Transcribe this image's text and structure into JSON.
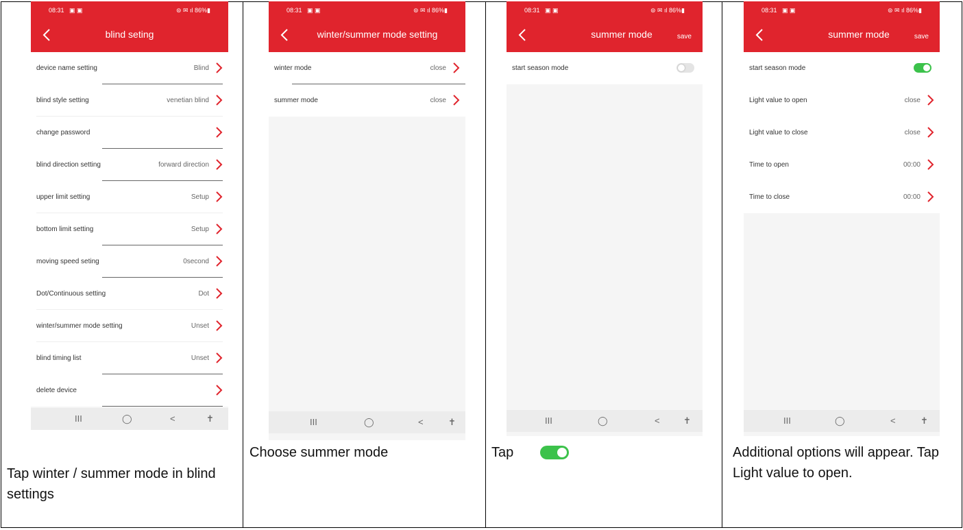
{
  "colors": {
    "accent": "#e0242d",
    "toggle_on": "#3cc24b",
    "toggle_off": "#e4e4e4"
  },
  "status_bar": {
    "time": "08:31",
    "icons": "▣ ▣",
    "right": "⊜ ✉ ıl 86%▮"
  },
  "nav_icons": {
    "recents": "III",
    "home": "◯",
    "back": "<",
    "accessibility": "✝"
  },
  "panel1": {
    "title": "blind seting",
    "rows": [
      {
        "label": "device name setting",
        "value": "Blind"
      },
      {
        "label": "blind style setting",
        "value": "venetian blind"
      },
      {
        "label": "change password",
        "value": ""
      },
      {
        "label": "blind direction setting",
        "value": "forward direction"
      },
      {
        "label": "upper limit setting",
        "value": "Setup"
      },
      {
        "label": "bottom limit setting",
        "value": "Setup"
      },
      {
        "label": "moving speed seting",
        "value": "0second"
      },
      {
        "label": "Dot/Continuous setting",
        "value": "Dot"
      },
      {
        "label": "winter/summer mode setting",
        "value": "Unset"
      },
      {
        "label": "blind timing list",
        "value": "Unset"
      },
      {
        "label": "delete device",
        "value": ""
      }
    ],
    "caption": "Tap winter / summer mode in blind settings"
  },
  "panel2": {
    "title": "winter/summer mode setting",
    "rows": [
      {
        "label": "winter mode",
        "value": "close"
      },
      {
        "label": "summer mode",
        "value": "close"
      }
    ],
    "caption": "Choose summer mode"
  },
  "panel3": {
    "title": "summer mode",
    "save": "save",
    "toggle_label": "start season mode",
    "toggle_state": "off",
    "caption": "Tap"
  },
  "panel4": {
    "title": "summer mode",
    "save": "save",
    "toggle_label": "start season mode",
    "toggle_state": "on",
    "rows": [
      {
        "label": "Light value to open",
        "value": "close"
      },
      {
        "label": "Light value to close",
        "value": "close"
      },
      {
        "label": "Time to open",
        "value": "00:00"
      },
      {
        "label": "Time to close",
        "value": "00:00"
      }
    ],
    "caption": "Additional options will appear. Tap Light value to open."
  }
}
